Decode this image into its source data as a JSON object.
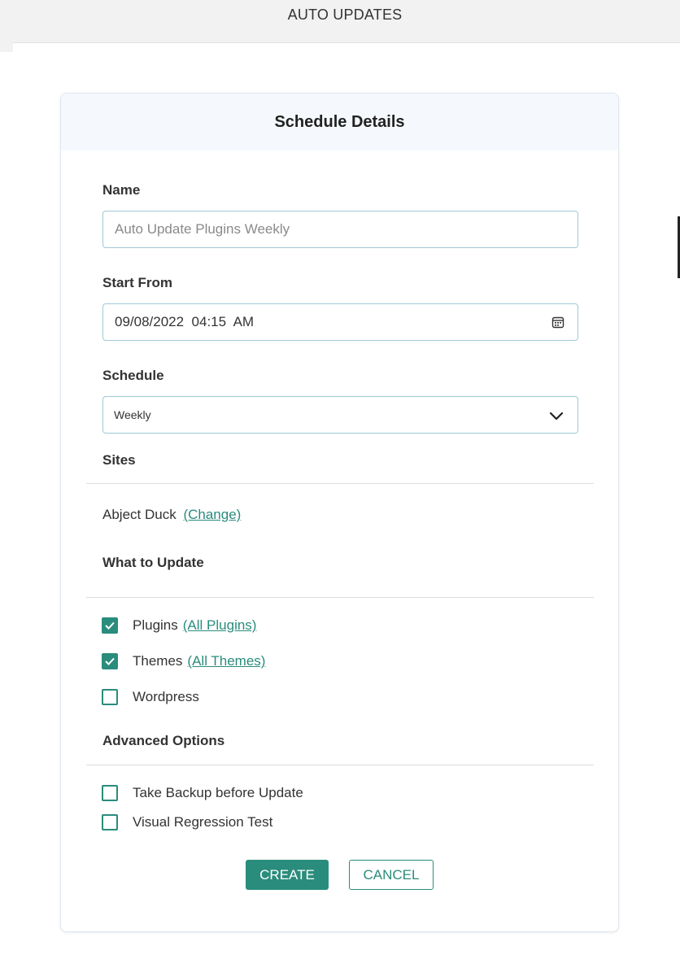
{
  "page": {
    "title": "AUTO UPDATES"
  },
  "card": {
    "title": "Schedule Details"
  },
  "form": {
    "name_label": "Name",
    "name_placeholder": "Auto Update Plugins Weekly",
    "start_label": "Start From",
    "start_value": "09/08/2022  04:15  AM",
    "schedule_label": "Schedule",
    "schedule_value": "Weekly"
  },
  "sites": {
    "heading": "Sites",
    "site_name": "Abject Duck",
    "change_link": "(Change)"
  },
  "what_to_update": {
    "heading": "What to Update",
    "items": [
      {
        "label": "Plugins",
        "link": "(All Plugins)",
        "checked": true
      },
      {
        "label": "Themes",
        "link": "(All Themes)",
        "checked": true
      },
      {
        "label": "Wordpress",
        "link": "",
        "checked": false
      }
    ]
  },
  "advanced": {
    "heading": "Advanced Options",
    "items": [
      {
        "label": "Take Backup before Update",
        "checked": false
      },
      {
        "label": "Visual Regression Test",
        "checked": false
      }
    ]
  },
  "buttons": {
    "create": "CREATE",
    "cancel": "CANCEL"
  },
  "colors": {
    "accent": "#2a8c7c",
    "header_bg": "#f5f9fd",
    "field_border": "#9ec9d6"
  },
  "icons": {
    "date": "calendar-icon",
    "select": "chevron-down-icon",
    "check": "checkmark-icon"
  }
}
